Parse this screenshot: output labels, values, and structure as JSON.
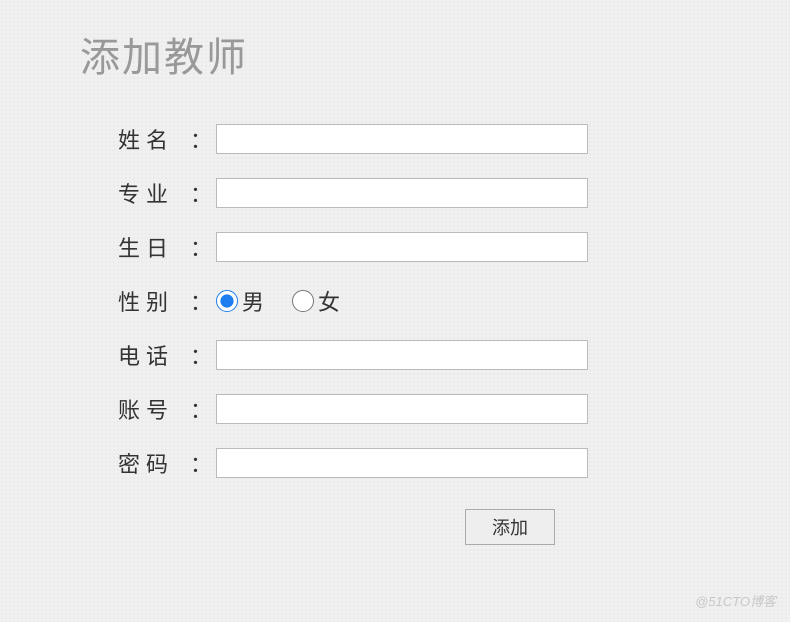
{
  "page": {
    "title": "添加教师"
  },
  "form": {
    "fields": {
      "name": {
        "label": "姓名",
        "value": ""
      },
      "major": {
        "label": "专业",
        "value": ""
      },
      "birthday": {
        "label": "生日",
        "value": ""
      },
      "gender": {
        "label": "性别",
        "options": [
          {
            "label": "男",
            "value": "male",
            "checked": true
          },
          {
            "label": "女",
            "value": "female",
            "checked": false
          }
        ]
      },
      "phone": {
        "label": "电话",
        "value": ""
      },
      "account": {
        "label": "账号",
        "value": ""
      },
      "password": {
        "label": "密码",
        "value": ""
      }
    },
    "colon": "：",
    "submit_label": "添加"
  },
  "watermark": "@51CTO博客"
}
